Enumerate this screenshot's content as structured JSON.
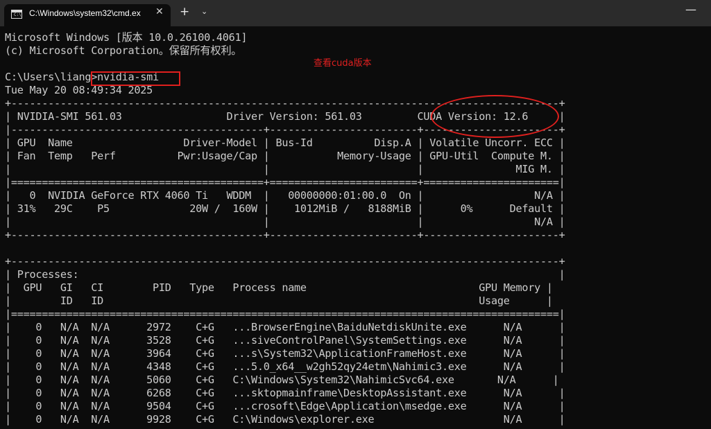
{
  "window": {
    "tab_title": "C:\\Windows\\system32\\cmd.ex",
    "tab_close": "✕",
    "new_tab": "+",
    "dropdown": "⌄",
    "minimize": "—"
  },
  "console_lines": [
    "Microsoft Windows [版本 10.0.26100.4061]",
    "(c) Microsoft Corporation。保留所有权利。",
    "",
    "C:\\Users\\liang>nvidia-smi",
    "Tue May 20 08:49:34 2025",
    "+-----------------------------------------------------------------------------------------+",
    "| NVIDIA-SMI 561.03                 Driver Version: 561.03         CUDA Version: 12.6     |",
    "|-----------------------------------------+------------------------+----------------------+",
    "| GPU  Name                  Driver-Model | Bus-Id          Disp.A | Volatile Uncorr. ECC |",
    "| Fan  Temp   Perf          Pwr:Usage/Cap |           Memory-Usage | GPU-Util  Compute M. |",
    "|                                         |                        |               MIG M. |",
    "|=========================================+========================+======================|",
    "|   0  NVIDIA GeForce RTX 4060 Ti   WDDM  |   00000000:01:00.0  On |                  N/A |",
    "| 31%   29C    P5             20W /  160W |    1012MiB /   8188MiB |      0%      Default |",
    "|                                         |                        |                  N/A |",
    "+-----------------------------------------+------------------------+----------------------+",
    "",
    "+-----------------------------------------------------------------------------------------+",
    "| Processes:                                                                              |",
    "|  GPU   GI   CI        PID   Type   Process name                            GPU Memory |",
    "|        ID   ID                                                             Usage      |",
    "|=========================================================================================|",
    "|    0   N/A  N/A      2972    C+G   ...BrowserEngine\\BaiduNetdiskUnite.exe      N/A      |",
    "|    0   N/A  N/A      3528    C+G   ...siveControlPanel\\SystemSettings.exe      N/A      |",
    "|    0   N/A  N/A      3964    C+G   ...s\\System32\\ApplicationFrameHost.exe      N/A      |",
    "|    0   N/A  N/A      4348    C+G   ...5.0_x64__w2gh52qy24etm\\Nahimic3.exe      N/A      |",
    "|    0   N/A  N/A      5060    C+G   C:\\Windows\\System32\\NahimicSvc64.exe       N/A      |",
    "|    0   N/A  N/A      6268    C+G   ...sktopmainframe\\DesktopAssistant.exe      N/A      |",
    "|    0   N/A  N/A      9504    C+G   ...crosoft\\Edge\\Application\\msedge.exe      N/A      |",
    "|    0   N/A  N/A      9928    C+G   C:\\Windows\\explorer.exe                     N/A      |"
  ],
  "annotation": {
    "text": "查看cuda版本",
    "color": "#e02020"
  },
  "icons": {
    "tab_icon": "cmd-icon",
    "tab_icon_text": "C:\\"
  }
}
